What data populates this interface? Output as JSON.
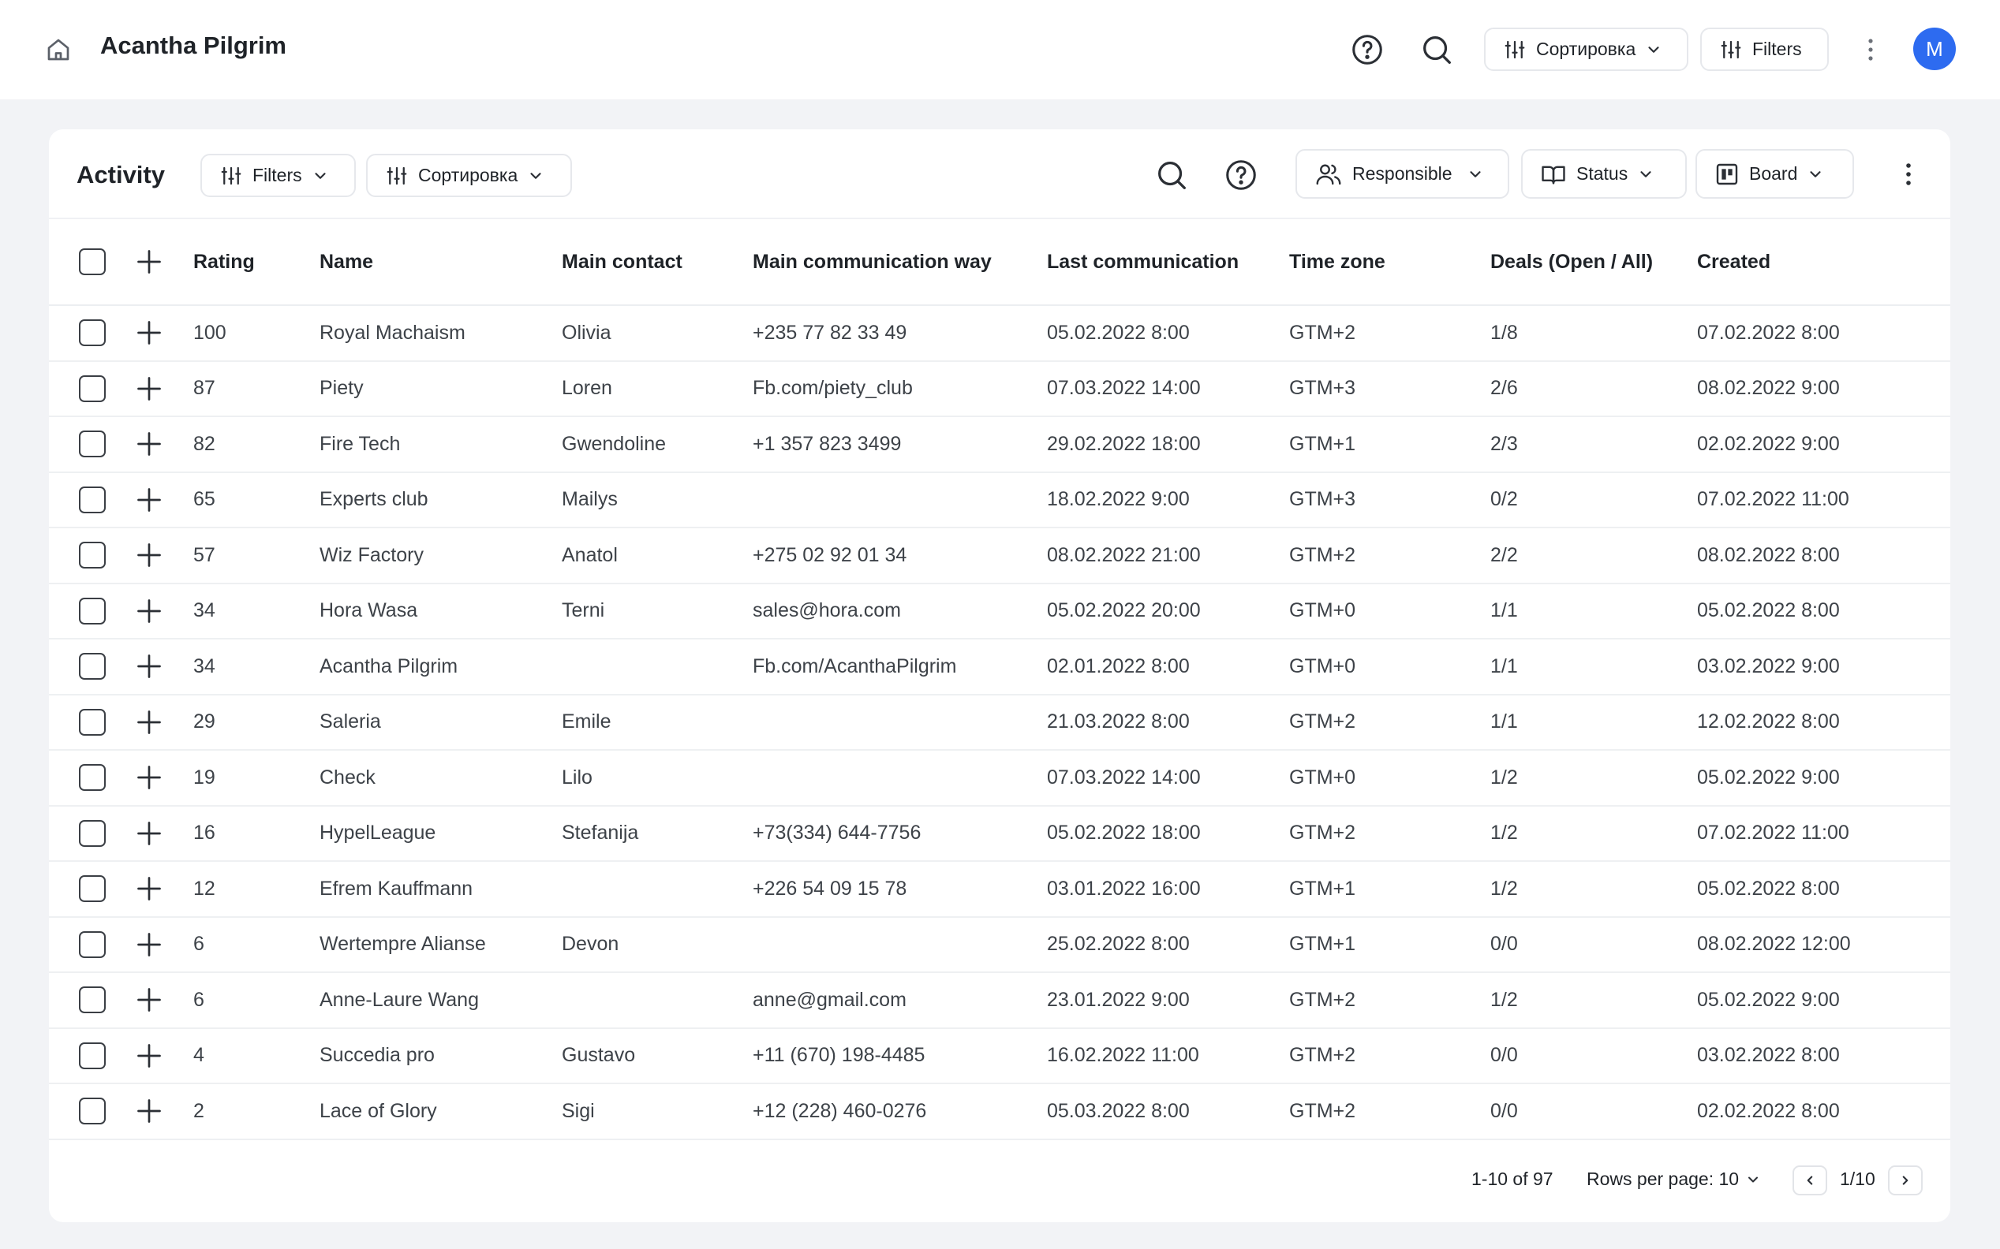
{
  "app": {
    "title": "Acantha Pilgrim",
    "avatar_initial": "M",
    "accent": "#2d6bf0"
  },
  "topbar": {
    "sort_label": "Сортировка",
    "filters_label": "Filters",
    "icons": [
      "home-icon",
      "help-icon",
      "search-icon",
      "sliders-icon",
      "kebab-icon"
    ]
  },
  "card": {
    "title": "Activity",
    "filters_label": "Filters",
    "sort_label": "Сортировка",
    "responsible_label": "Responsible",
    "status_label": "Status",
    "board_label": "Board"
  },
  "table": {
    "columns": [
      "Rating",
      "Name",
      "Main contact",
      "Main communication way",
      "Last communication",
      "Time zone",
      "Deals (Open / All)",
      "Created"
    ],
    "rows": [
      [
        "100",
        "Royal Machaism",
        "Olivia",
        "+235 77 82 33 49",
        "05.02.2022 8:00",
        "GTM+2",
        "1/8",
        "07.02.2022 8:00"
      ],
      [
        "87",
        "Piety",
        "Loren",
        "Fb.com/piety_club",
        "07.03.2022 14:00",
        "GTM+3",
        "2/6",
        "08.02.2022 9:00"
      ],
      [
        "82",
        "Fire Tech",
        "Gwendoline",
        "+1 357 823 3499",
        "29.02.2022 18:00",
        "GTM+1",
        "2/3",
        "02.02.2022 9:00"
      ],
      [
        "65",
        "Experts club",
        "Mailys",
        "",
        "18.02.2022 9:00",
        "GTM+3",
        "0/2",
        "07.02.2022 11:00"
      ],
      [
        "57",
        "Wiz Factory",
        "Anatol",
        "+275 02 92 01 34",
        "08.02.2022 21:00",
        "GTM+2",
        "2/2",
        "08.02.2022 8:00"
      ],
      [
        "34",
        "Hora Wasa",
        "Terni",
        "sales@hora.com",
        "05.02.2022 20:00",
        "GTM+0",
        "1/1",
        "05.02.2022 8:00"
      ],
      [
        "34",
        "Acantha Pilgrim",
        "",
        "Fb.com/AcanthaPilgrim",
        "02.01.2022 8:00",
        "GTM+0",
        "1/1",
        "03.02.2022 9:00"
      ],
      [
        "29",
        "Saleria",
        "Emile",
        "",
        "21.03.2022 8:00",
        "GTM+2",
        "1/1",
        "12.02.2022 8:00"
      ],
      [
        "19",
        "Check",
        "Lilo",
        "",
        "07.03.2022 14:00",
        "GTM+0",
        "1/2",
        "05.02.2022 9:00"
      ],
      [
        "16",
        "HypelLeague",
        "Stefanija",
        "+73(334) 644-7756",
        "05.02.2022 18:00",
        "GTM+2",
        "1/2",
        "07.02.2022 11:00"
      ],
      [
        "12",
        "Efrem Kauffmann",
        "",
        "+226 54 09 15 78",
        "03.01.2022 16:00",
        "GTM+1",
        "1/2",
        "05.02.2022 8:00"
      ],
      [
        "6",
        "Wertempre Alianse",
        "Devon",
        "",
        "25.02.2022 8:00",
        "GTM+1",
        "0/0",
        "08.02.2022 12:00"
      ],
      [
        "6",
        "Anne-Laure Wang",
        "",
        "anne@gmail.com",
        "23.01.2022 9:00",
        "GTM+2",
        "1/2",
        "05.02.2022 9:00"
      ],
      [
        "4",
        "Succedia pro",
        "Gustavo",
        "+11 (670) 198-4485",
        "16.02.2022 11:00",
        "GTM+2",
        "0/0",
        "03.02.2022 8:00"
      ],
      [
        "2",
        "Lace of Glory",
        "Sigi",
        "+12 (228) 460-0276",
        "05.03.2022 8:00",
        "GTM+2",
        "0/0",
        "02.02.2022 8:00"
      ]
    ]
  },
  "pagination": {
    "range": "1-10 of 97",
    "rows_per_page": "Rows per page: 10",
    "current": "1/10"
  }
}
